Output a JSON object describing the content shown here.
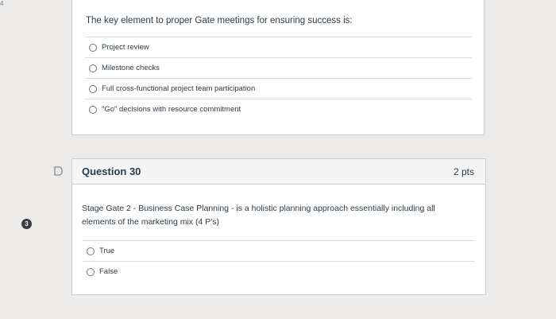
{
  "corner_mark": "4",
  "question_29": {
    "text": "The key element to proper Gate meetings for ensuring success is:",
    "answers": [
      "Project review",
      "Milestone checks",
      "Full cross-functional project team participation",
      "\"Go\" decisions with resource commitment"
    ]
  },
  "question_30": {
    "title": "Question 30",
    "points": "2 pts",
    "badge": "3",
    "text": "Stage Gate 2 - Business Case Planning - is a holistic planning approach essentially including all elements of the marketing mix (4 P's)",
    "answers": [
      "True",
      "False"
    ]
  }
}
